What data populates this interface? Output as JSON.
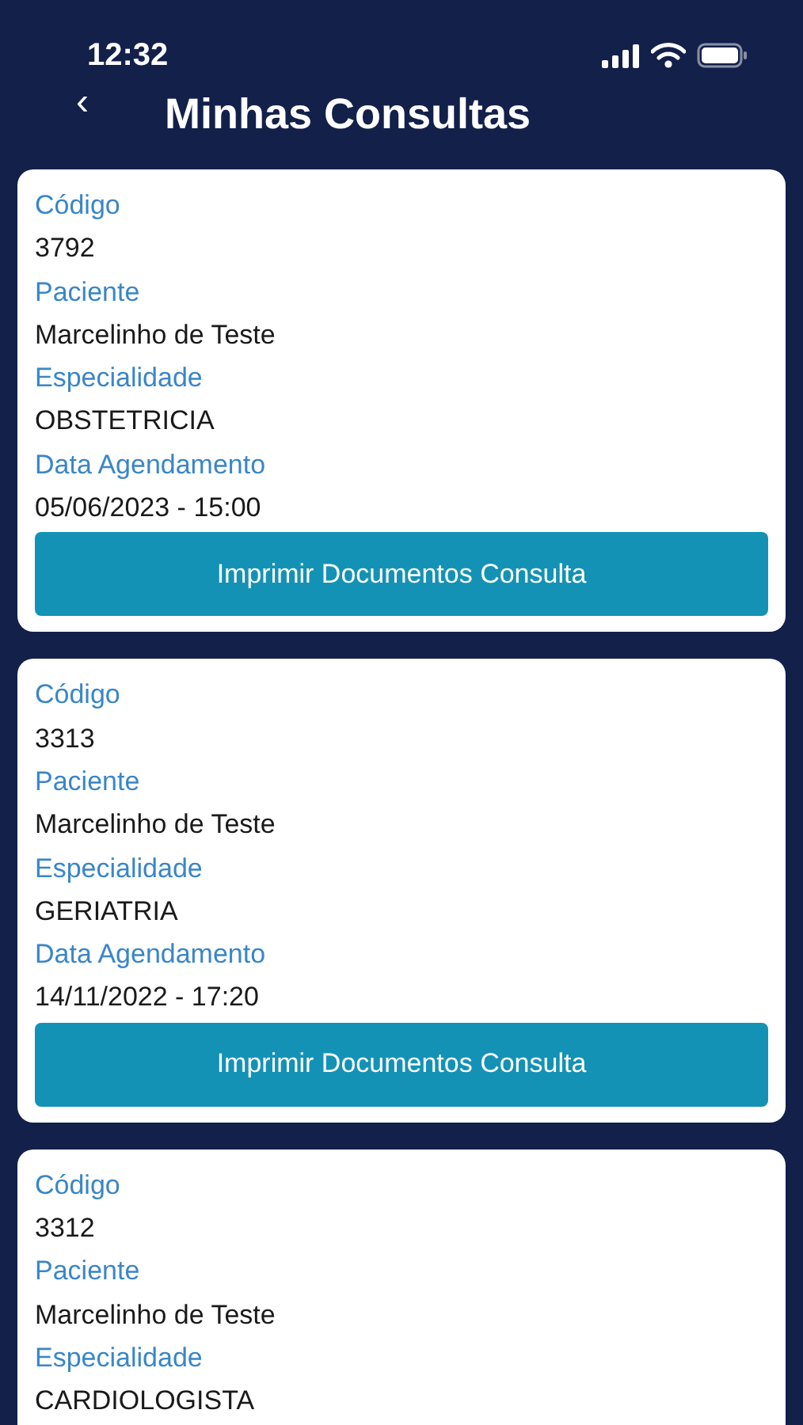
{
  "status_bar": {
    "time": "12:32"
  },
  "header": {
    "back": "‹",
    "title": "Minhas Consultas"
  },
  "cards": [
    {
      "fields": [
        {
          "label": "Código",
          "value": "3792"
        },
        {
          "label": "Paciente",
          "value": "Marcelinho de Teste"
        },
        {
          "label": "Especialidade",
          "value": "OBSTETRICIA"
        },
        {
          "label": "Data Agendamento",
          "value": "05/06/2023 - 15:00"
        }
      ],
      "button": "Imprimir Documentos Consulta"
    },
    {
      "fields": [
        {
          "label": "Código",
          "value": "3313"
        },
        {
          "label": "Paciente",
          "value": "Marcelinho de Teste"
        },
        {
          "label": "Especialidade",
          "value": "GERIATRIA"
        },
        {
          "label": "Data Agendamento",
          "value": "14/11/2022 - 17:20"
        }
      ],
      "button": "Imprimir Documentos Consulta"
    },
    {
      "fields": [
        {
          "label": "Código",
          "value": "3312"
        },
        {
          "label": "Paciente",
          "value": "Marcelinho de Teste"
        },
        {
          "label": "Especialidade",
          "value": "CARDIOLOGISTA"
        }
      ]
    }
  ]
}
